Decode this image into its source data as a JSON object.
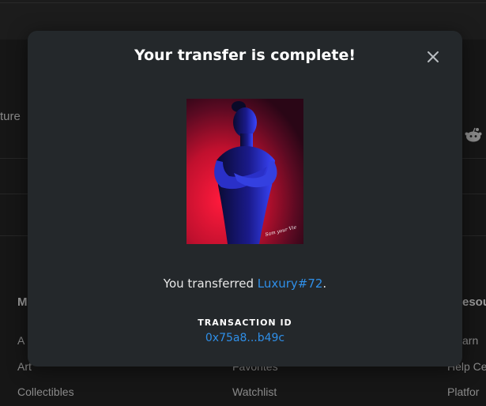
{
  "background": {
    "partial_text_left": "ture",
    "column_left_heading": "M",
    "column_left_items": [
      "A",
      "Art",
      "Collectibles"
    ],
    "column_mid_items": [
      "Favorites",
      "Watchlist"
    ],
    "column_right_heading": "esou",
    "column_right_items": [
      "arn",
      "Help Ce",
      "Platfor"
    ],
    "icon": "reddit-icon"
  },
  "modal": {
    "title": "Your transfer is complete!",
    "close_icon": "close-icon",
    "image_alt_signature": "Sam your Vie",
    "transfer_prefix": "You transferred ",
    "item_link": "Luxury#72",
    "transfer_suffix": ".",
    "transaction_label": "TRANSACTION ID",
    "transaction_id": "0x75a8...b49c"
  },
  "colors": {
    "modal_bg": "#24282b",
    "link": "#2f8fe8",
    "title": "#ffffff"
  }
}
